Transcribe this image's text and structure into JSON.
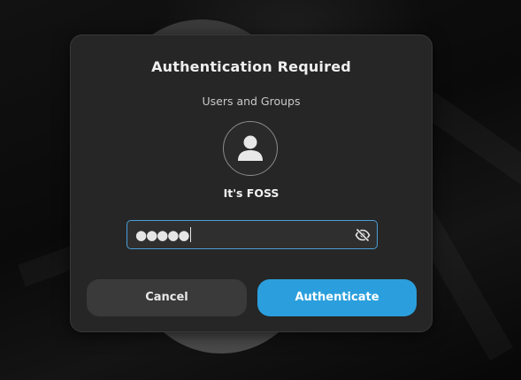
{
  "dialog": {
    "title": "Authentication Required",
    "subtitle": "Users and Groups",
    "avatar_icon": "user-avatar-icon",
    "username": "It's FOSS",
    "password": {
      "masked_value": "●●●●●",
      "reveal_icon": "eye-slash-icon"
    },
    "buttons": {
      "cancel_label": "Cancel",
      "authenticate_label": "Authenticate"
    }
  },
  "colors": {
    "accent": "#2b9fdd",
    "dialog_bg": "#262626",
    "field_focus_border": "#4a9fd8"
  }
}
